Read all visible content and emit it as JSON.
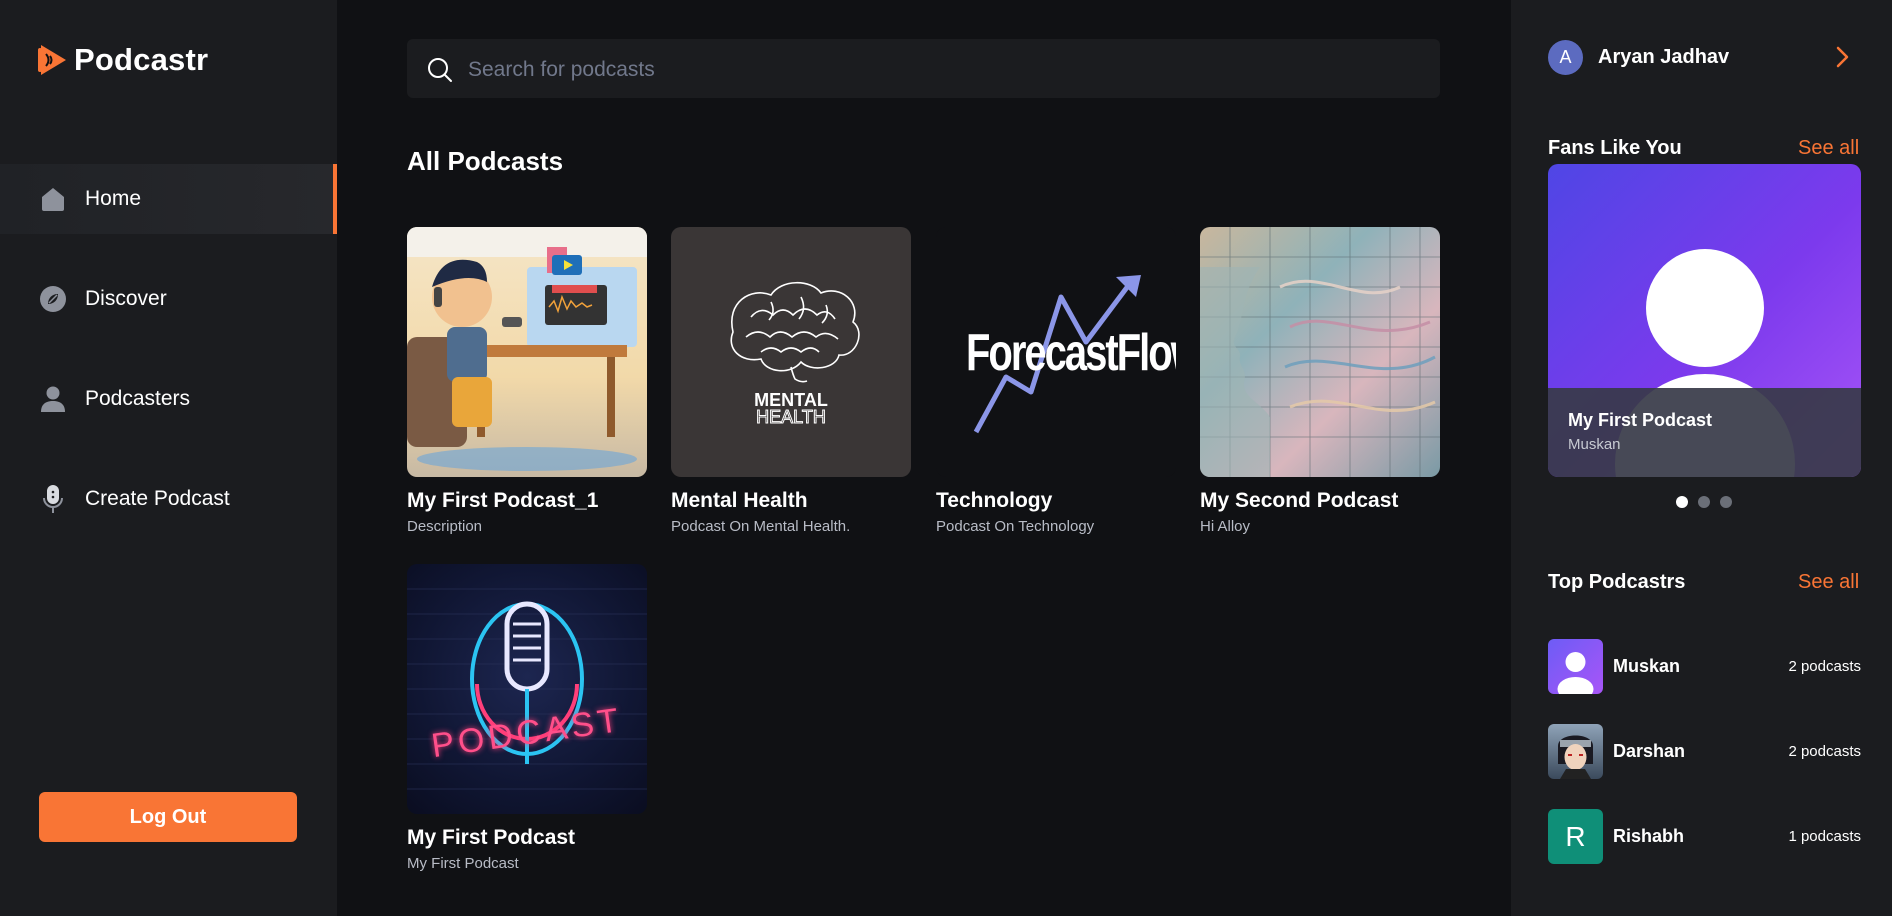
{
  "app": {
    "name": "Podcastr"
  },
  "nav": {
    "items": [
      {
        "label": "Home",
        "icon": "home-icon",
        "active": true
      },
      {
        "label": "Discover",
        "icon": "compass-icon",
        "active": false
      },
      {
        "label": "Podcasters",
        "icon": "user-icon",
        "active": false
      },
      {
        "label": "Create Podcast",
        "icon": "microphone-icon",
        "active": false
      }
    ],
    "logout_label": "Log Out"
  },
  "search": {
    "placeholder": "Search for podcasts",
    "value": ""
  },
  "main": {
    "section_title": "All Podcasts",
    "podcasts": [
      {
        "title": "My First Podcast_1",
        "description": "Description",
        "thumb": "boy-podcast-illustration"
      },
      {
        "title": "Mental Health",
        "description": "Podcast On Mental Health.",
        "thumb": "brain-logo",
        "thumb_line1": "MENTAL",
        "thumb_line2": "HEALTH"
      },
      {
        "title": "Technology",
        "description": "Podcast On Technology",
        "thumb": "forecastflow-logo",
        "thumb_text": "ForecastFlow"
      },
      {
        "title": "My Second Podcast",
        "description": "Hi Alloy",
        "thumb": "abstract-face-art"
      },
      {
        "title": "My First Podcast",
        "description": "My First Podcast",
        "thumb": "neon-microphone",
        "thumb_text": "PODCAST"
      }
    ]
  },
  "profile": {
    "initial": "A",
    "name": "Aryan Jadhav"
  },
  "fans": {
    "title": "Fans Like You",
    "see_all": "See all",
    "carousel": {
      "title": "My First Podcast",
      "author": "Muskan",
      "slides": 3,
      "active_slide": 1
    }
  },
  "top_podcastrs": {
    "title": "Top Podcastrs",
    "see_all": "See all",
    "items": [
      {
        "name": "Muskan",
        "count": "2 podcasts",
        "avatar": "default-user-avatar"
      },
      {
        "name": "Darshan",
        "count": "2 podcasts",
        "avatar": "anime-character-avatar"
      },
      {
        "name": "Rishabh",
        "count": "1 podcasts",
        "avatar": "initial-avatar",
        "initial": "R"
      }
    ]
  },
  "colors": {
    "accent": "#f97535",
    "background": "#101114",
    "panel": "#1b1c1f"
  }
}
